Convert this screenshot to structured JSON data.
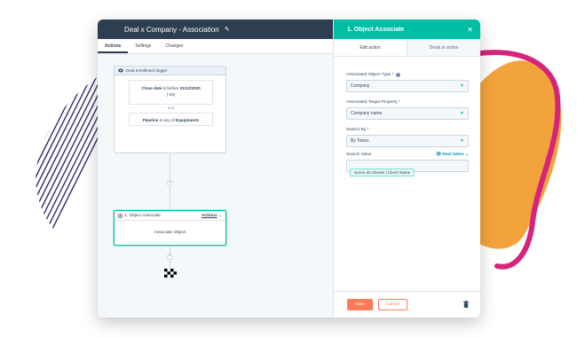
{
  "workflow": {
    "title": "Deal x Company - Association",
    "tabs": [
      "Actions",
      "Settings",
      "Changes"
    ],
    "trigger": {
      "heading": "Deal enrollment trigger",
      "condition1": {
        "field": "Close date",
        "op": "is before",
        "value": "31/12/2020",
        "extra": "(-03)"
      },
      "and_label": "and",
      "condition2": {
        "field": "Pipeline",
        "op": "is any of",
        "value": "Equipments"
      }
    },
    "action": {
      "heading": "1. Object Associate",
      "menu_label": "Actions",
      "body": "Associate Object"
    }
  },
  "panel": {
    "title": "1. Object Associate",
    "tabs": [
      "Edit action",
      "Deals in action"
    ],
    "fields": {
      "object_type_label": "Associated Object Type *",
      "object_type_value": "Company",
      "target_property_label": "Associated Target Property *",
      "target_property_value": "Company name",
      "search_by_label": "Search By *",
      "search_by_value": "By Token",
      "search_value_label": "Search Value",
      "token_link": "Deal token",
      "token_chip": "Nome do Cliente | Client Name"
    },
    "footer": {
      "save_label": "Save",
      "cancel_label": "Cancel"
    }
  },
  "colors": {
    "accent": "#00bda5",
    "header": "#2d3e50",
    "primary_button": "#ff7a59",
    "deco_orange": "#f2a43a",
    "deco_magenta": "#d6247a",
    "deco_lines": "#3b2a6e"
  },
  "icons": [
    "pencil-icon",
    "eye-icon",
    "close-icon",
    "plus-icon",
    "checkered-flag-icon",
    "info-icon",
    "chevron-down-icon",
    "trash-icon"
  ]
}
